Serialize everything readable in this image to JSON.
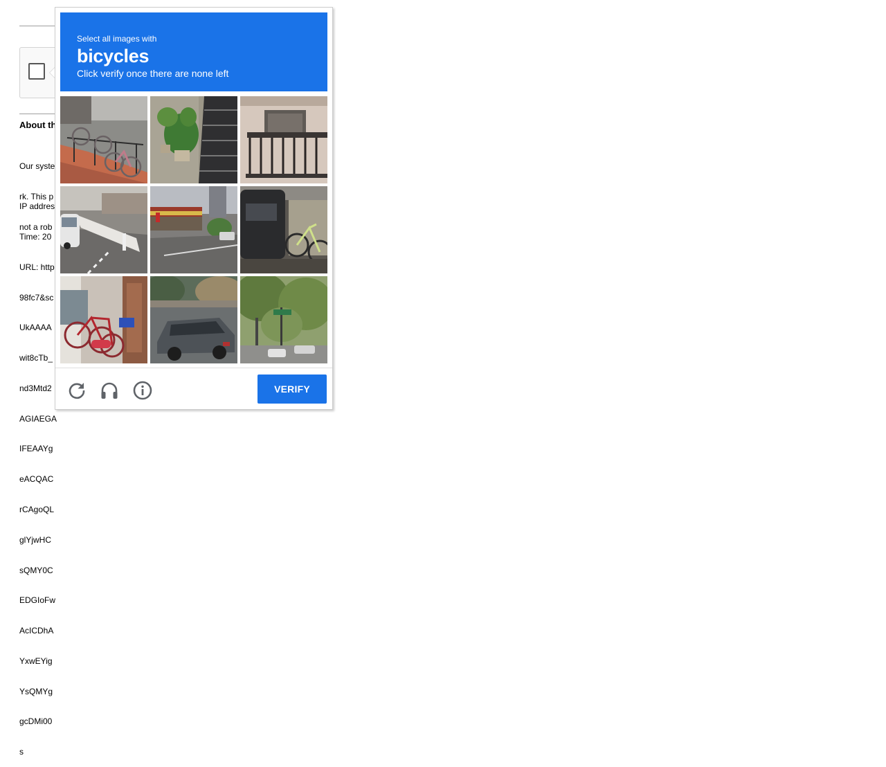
{
  "background_page": {
    "heading": "About th",
    "paragraph_lines": [
      "Our syste",
      "rk. This p",
      "not a rob"
    ],
    "info_lines": [
      "IP addres",
      "Time: 20",
      "URL: http",
      "98fc7&sc",
      "UkAAAA",
      "wit8cTb_",
      "nd3Mtd2",
      "AGIAEGA",
      "IFEAAYg",
      "eACQAC",
      "rCAgoQL",
      "glYjwHC",
      "sQMY0C",
      "EDGIoFw",
      "AcICDhA",
      "YxwEYig",
      "YsQMYg",
      "gcDMi00",
      "s"
    ]
  },
  "captcha": {
    "instruction_small": "Select all images with",
    "target_object": "bicycles",
    "instruction_sub": "Click verify once there are none left",
    "verify_label": "VERIFY",
    "accent_color": "#1a73e8",
    "tiles": [
      {
        "name": "tile-bicycles-railing"
      },
      {
        "name": "tile-plants-stairs"
      },
      {
        "name": "tile-house-balcony"
      },
      {
        "name": "tile-street-car"
      },
      {
        "name": "tile-mcdonalds-street"
      },
      {
        "name": "tile-garage-bicycle"
      },
      {
        "name": "tile-red-bicycles"
      },
      {
        "name": "tile-gray-car"
      },
      {
        "name": "tile-trees-sign"
      }
    ],
    "footer_icons": [
      "reload-icon",
      "audio-headphones-icon",
      "info-icon"
    ]
  }
}
